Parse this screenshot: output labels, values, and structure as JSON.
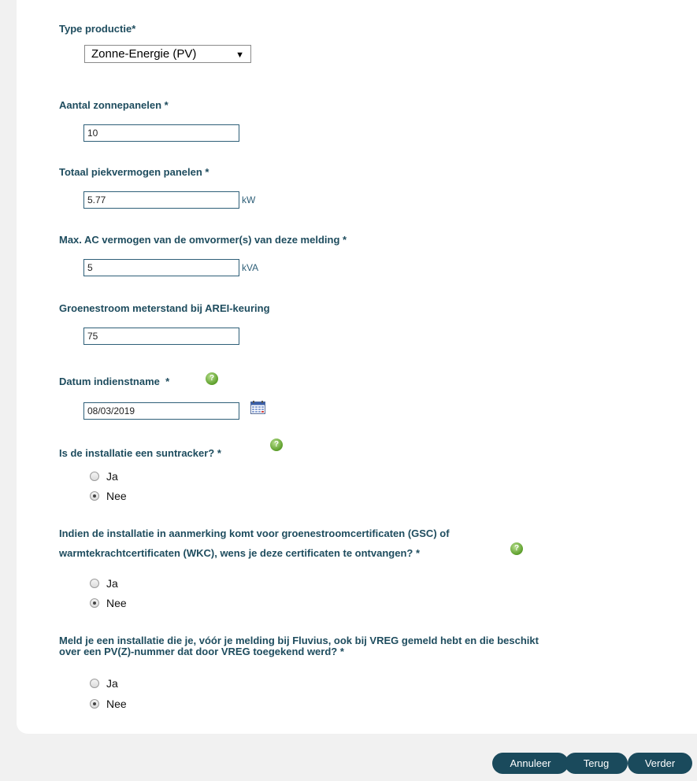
{
  "form": {
    "type_productie": {
      "label": "Type productie*",
      "selected": "Zonne-Energie (PV)"
    },
    "aantal_zonnepanelen": {
      "label": "Aantal zonnepanelen *",
      "value": "10"
    },
    "totaal_piekvermogen": {
      "label": "Totaal piekvermogen panelen *",
      "value": "5.77",
      "unit": "kW"
    },
    "max_ac_vermogen": {
      "label": "Max. AC vermogen van de omvormer(s) van deze melding *",
      "value": "5",
      "unit": "kVA"
    },
    "groenestroom_meterstand": {
      "label": "Groenestroom meterstand bij AREI-keuring",
      "value": "75"
    },
    "datum_indienstname": {
      "label": "Datum indienstname  *",
      "value": "08/03/2019"
    },
    "suntracker": {
      "label": "Is de installatie een suntracker? *",
      "options": [
        {
          "label": "Ja",
          "checked": false
        },
        {
          "label": "Nee",
          "checked": true
        }
      ]
    },
    "certificaten": {
      "label_line1": "Indien de installatie in aanmerking komt voor groenestroomcertificaten (GSC) of",
      "label_line2": "warmtekrachtcertificaten (WKC), wens je deze certificaten te ontvangen? *",
      "options": [
        {
          "label": "Ja",
          "checked": false
        },
        {
          "label": "Nee",
          "checked": true
        }
      ]
    },
    "vreg": {
      "label_line1": "Meld je een installatie die je, vóór je melding bij Fluvius, ook bij VREG gemeld hebt en die beschikt",
      "label_line2": "over een PV(Z)-nummer dat door VREG toegekend werd? *",
      "options": [
        {
          "label": "Ja",
          "checked": false
        },
        {
          "label": "Nee",
          "checked": true
        }
      ]
    }
  },
  "buttons": {
    "annuleer": "Annuleer",
    "terug": "Terug",
    "verder": "Verder"
  },
  "icons": {
    "help": "help-question-icon",
    "calendar": "calendar-icon",
    "dropdown": "triangle-down-icon"
  },
  "colors": {
    "label": "#1e4c5e",
    "button": "#1a4a5c",
    "help": "#5c9e2a"
  }
}
